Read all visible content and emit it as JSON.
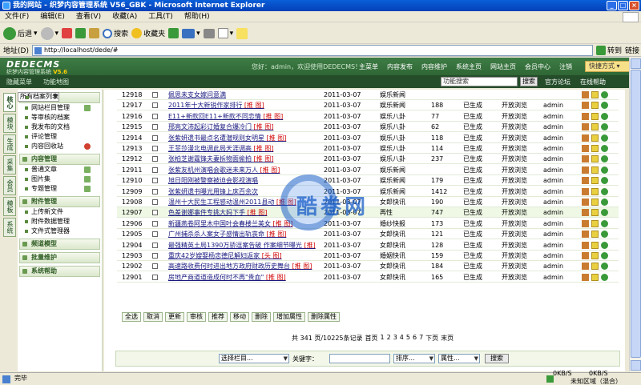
{
  "window": {
    "title": "我的网站 - 织梦内容管理系统 V56_GBK - Microsoft Internet Explorer"
  },
  "ie_menu": [
    "文件(F)",
    "编辑(E)",
    "查看(V)",
    "收藏(A)",
    "工具(T)",
    "帮助(H)"
  ],
  "ie_toolbar": {
    "back": "后退",
    "search": "搜索",
    "favorites": "收藏夹"
  },
  "address": {
    "label": "地址(D)",
    "url": "http://localhost/dede/#",
    "go": "转到",
    "links": "链接"
  },
  "dede": {
    "logo": "DEDECMS",
    "logo_sub": "织梦内容管理系统",
    "version": "V5.6",
    "welcome": "您好：admin，欢迎使用DEDECMS！",
    "nav": [
      "主菜单",
      "内容发布",
      "内容维护",
      "系统主页",
      "网站主页",
      "会员中心",
      "注销"
    ],
    "quick": "快捷方式 ▾",
    "sub_left": [
      "隐藏菜单",
      "功能地图"
    ],
    "func_search": "功能搜索",
    "search_btn": "搜索",
    "forum": "官方论坛",
    "help": "在线帮助"
  },
  "vtabs": [
    "核心",
    "模块",
    "生成",
    "采集",
    "会员",
    "模板",
    "系统"
  ],
  "menu": {
    "common": {
      "title": "常用操作",
      "items": [
        "网站栏目管理",
        "所有档案列表",
        "等审核的档案",
        "我发布的文档",
        "评论管理",
        "内容回收站"
      ]
    },
    "content": {
      "title": "内容管理",
      "items": [
        "普通文章",
        "图片集",
        "专题管理"
      ]
    },
    "attach": {
      "title": "附件管理",
      "items": [
        "上传新文件",
        "附件数据管理",
        "文件式管理器"
      ]
    },
    "channel": "频道模型",
    "batch": "批量维护",
    "syshelp": "系统帮助"
  },
  "rows": [
    {
      "id": "12918",
      "title": "佩思未支女嫁问意满",
      "tag": "",
      "date": "2011-03-07",
      "cat": "娱乐新闻",
      "click": "",
      "gen": "",
      "browse": "",
      "user": ""
    },
    {
      "id": "12917",
      "title": "2011年十大新锐作家排行",
      "tag": "[推 图]",
      "date": "2011-03-07",
      "cat": "娱乐新闻",
      "click": "188",
      "gen": "已生成",
      "browse": "开放浏览",
      "user": "admin"
    },
    {
      "id": "12916",
      "title": "E11+新款回E11+新款不同恋情",
      "tag": "[推 图]",
      "date": "2011-03-07",
      "cat": "娱乐八卦",
      "click": "77",
      "gen": "已生成",
      "browse": "开放浏览",
      "user": "admin"
    },
    {
      "id": "12915",
      "title": "邢亮文沛起彩订婚复合爆冷门",
      "tag": "[推 图]",
      "date": "2011-03-07",
      "cat": "娱乐八卦",
      "click": "62",
      "gen": "已生成",
      "browse": "开放浏览",
      "user": "admin"
    },
    {
      "id": "12914",
      "title": "张紫妍遗书最点名遭潜规则女明星",
      "tag": "[推 图]",
      "date": "2011-03-07",
      "cat": "娱乐八卦",
      "click": "118",
      "gen": "已生成",
      "browse": "开放浏览",
      "user": "admin"
    },
    {
      "id": "12913",
      "title": "王菲莎漫北电调此局天涯调高",
      "tag": "[推 图]",
      "date": "2011-03-07",
      "cat": "娱乐八卦",
      "click": "114",
      "gen": "已生成",
      "browse": "开放浏览",
      "user": "admin"
    },
    {
      "id": "12912",
      "title": "张柏芝谢霆锋夫妻拆物面偷拍",
      "tag": "[推 图]",
      "date": "2011-03-07",
      "cat": "娱乐八卦",
      "click": "237",
      "gen": "已生成",
      "browse": "开放浏览",
      "user": "admin"
    },
    {
      "id": "12911",
      "title": "张紫友机州演唱会歌迷未来万人",
      "tag": "[推 图]",
      "date": "2011-03-07",
      "cat": "娱乐新闻",
      "click": "",
      "gen": "已生成",
      "browse": "开放浏览",
      "user": "admin"
    },
    {
      "id": "12910",
      "title": "旭日阳刚被警察被迫会影视演唱",
      "tag": "",
      "date": "2011-03-07",
      "cat": "娱乐新闻",
      "click": "179",
      "gen": "已生成",
      "browse": "开放浏览",
      "user": "admin"
    },
    {
      "id": "12909",
      "title": "张紫妍遗书曝光用锋上床百余次",
      "tag": "",
      "date": "2011-03-07",
      "cat": "娱乐新闻",
      "click": "1412",
      "gen": "已生成",
      "browse": "开放浏览",
      "user": "admin"
    },
    {
      "id": "12908",
      "title": "温州十大民生工程感动温州2011县动",
      "tag": "[推 图]",
      "date": "2011-03-07",
      "cat": "女郎快讯",
      "click": "190",
      "gen": "已生成",
      "browse": "开放浏览",
      "user": "admin"
    },
    {
      "id": "12907",
      "title": "色差谢娜事件专挑大妈下手",
      "tag": "[推 图]",
      "date": "2011-03-07",
      "cat": "再性",
      "click": "747",
      "gen": "已生成",
      "browse": "开放浏览",
      "user": "admin"
    },
    {
      "id": "12906",
      "title": "新疆燕卷阿里木中国叶会春楼兰美女",
      "tag": "[推 图]",
      "date": "2011-03-07",
      "cat": "婚纱快报",
      "click": "173",
      "gen": "已生成",
      "browse": "开放浏览",
      "user": "admin"
    },
    {
      "id": "12905",
      "title": "广州捕杀杀人案女子感情出轨丧命",
      "tag": "[推 图]",
      "date": "2011-03-07",
      "cat": "女郎快讯",
      "click": "121",
      "gen": "已生成",
      "browse": "开放浏览",
      "user": "admin"
    },
    {
      "id": "12904",
      "title": "最强精英土局1390万骄逗案告破 作案细节曝光",
      "tag": "[推]",
      "date": "2011-03-07",
      "cat": "女郎快讯",
      "click": "128",
      "gen": "已生成",
      "browse": "开放浏览",
      "user": "admin"
    },
    {
      "id": "12903",
      "title": "重庆42岁嫂娶杨忠德尼解妇返家",
      "tag": "[头 图]",
      "date": "2011-03-07",
      "cat": "婚姻快讯",
      "click": "159",
      "gen": "已生成",
      "browse": "开放浏览",
      "user": "admin"
    },
    {
      "id": "12902",
      "title": "高速路收费何时进出地方政府财政历史舞台",
      "tag": "[推 图]",
      "date": "2011-03-07",
      "cat": "女郎快讯",
      "click": "184",
      "gen": "已生成",
      "browse": "开放浏览",
      "user": "admin"
    },
    {
      "id": "12901",
      "title": "房地产商道道造成何时不再\"贵血\"",
      "tag": "[推 图]",
      "date": "2011-03-07",
      "cat": "女郎快讯",
      "click": "165",
      "gen": "已生成",
      "browse": "开放浏览",
      "user": "admin"
    }
  ],
  "actions": [
    "全选",
    "取消",
    "更新",
    "审核",
    "推荐",
    "移动",
    "删除",
    "增加属性",
    "删除属性"
  ],
  "pager": {
    "summary": "共 341 页/10225条记录",
    "home": "首页",
    "pages": [
      "1",
      "2",
      "3",
      "4",
      "5",
      "6",
      "7"
    ],
    "next": "下页",
    "last": "末页"
  },
  "search": {
    "category": "选择栏目...",
    "keyword_label": "关键字：",
    "order": "排序...",
    "attr": "属性...",
    "btn": "搜索"
  },
  "watermark": "酷卷网",
  "status": {
    "done": "完毕",
    "kb1": "0KB/S",
    "kb2": "0KB/S",
    "zone": "未知区域（混合）"
  }
}
